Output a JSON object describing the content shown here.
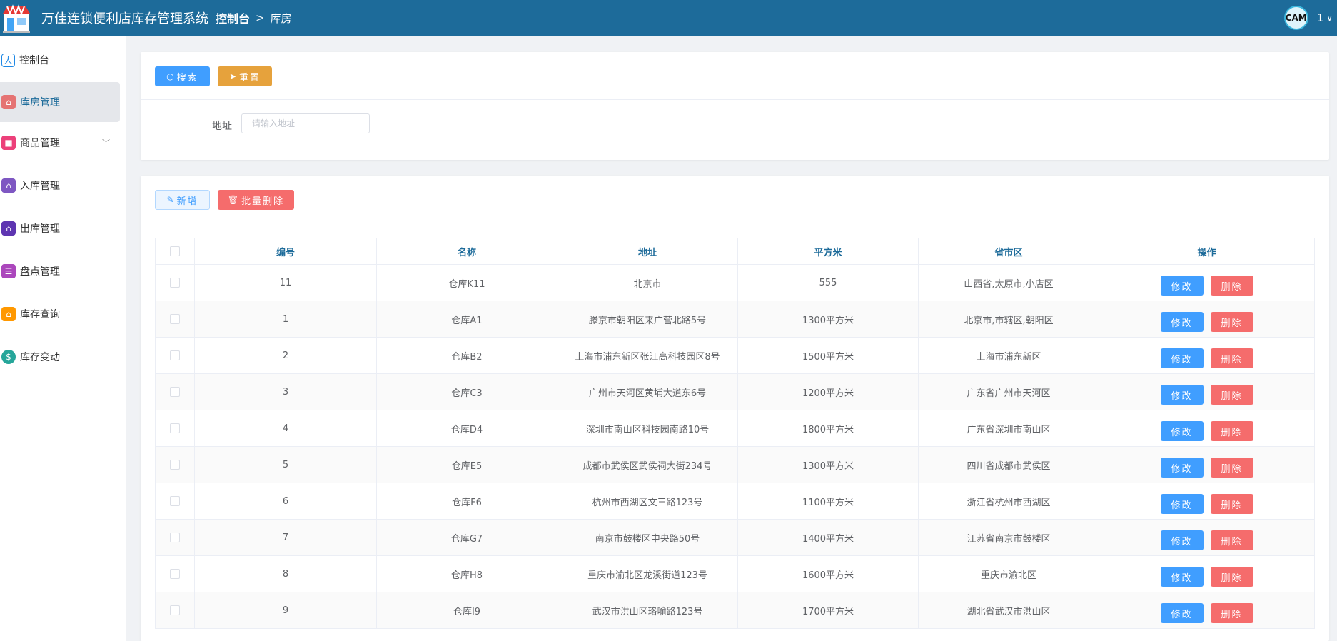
{
  "header": {
    "app_title": "万佳连锁便利店库存管理系统",
    "breadcrumb_home": "控制台",
    "breadcrumb_sep": ">",
    "breadcrumb_current": "库房",
    "avatar_text": "CAM",
    "user_name": "1",
    "user_chevron": "∨"
  },
  "sidebar": {
    "items": [
      {
        "label": "控制台",
        "icon": "dashboard-icon",
        "active": false
      },
      {
        "label": "库房管理",
        "icon": "warehouse-icon",
        "active": true
      },
      {
        "label": "商品管理",
        "icon": "goods-icon",
        "active": false,
        "chevron": "﹀"
      },
      {
        "label": "入库管理",
        "icon": "inbound-icon",
        "active": false
      },
      {
        "label": "出库管理",
        "icon": "outbound-icon",
        "active": false
      },
      {
        "label": "盘点管理",
        "icon": "inventory-check-icon",
        "active": false
      },
      {
        "label": "库存查询",
        "icon": "stock-query-icon",
        "active": false
      },
      {
        "label": "库存变动",
        "icon": "stock-change-icon",
        "active": false
      }
    ]
  },
  "search_card": {
    "search_label": "搜索",
    "reset_label": "重置",
    "address_label": "地址",
    "address_placeholder": "请输入地址",
    "address_value": ""
  },
  "table_card": {
    "add_label": "新增",
    "batch_delete_label": "批量删除",
    "columns": [
      "编号",
      "名称",
      "地址",
      "平方米",
      "省市区",
      "操作"
    ],
    "edit_label": "修改",
    "delete_label": "删除",
    "rows": [
      {
        "id": "11",
        "name": "仓库K11",
        "address": "北京市",
        "area": "555",
        "region": "山西省,太原市,小店区"
      },
      {
        "id": "1",
        "name": "仓库A1",
        "address": "滕京市朝阳区来广营北路5号",
        "area": "1300平方米",
        "region": "北京市,市辖区,朝阳区"
      },
      {
        "id": "2",
        "name": "仓库B2",
        "address": "上海市浦东新区张江高科技园区8号",
        "area": "1500平方米",
        "region": "上海市浦东新区"
      },
      {
        "id": "3",
        "name": "仓库C3",
        "address": "广州市天河区黄埔大道东6号",
        "area": "1200平方米",
        "region": "广东省广州市天河区"
      },
      {
        "id": "4",
        "name": "仓库D4",
        "address": "深圳市南山区科技园南路10号",
        "area": "1800平方米",
        "region": "广东省深圳市南山区"
      },
      {
        "id": "5",
        "name": "仓库E5",
        "address": "成都市武侯区武侯祠大街234号",
        "area": "1300平方米",
        "region": "四川省成都市武侯区"
      },
      {
        "id": "6",
        "name": "仓库F6",
        "address": "杭州市西湖区文三路123号",
        "area": "1100平方米",
        "region": "浙江省杭州市西湖区"
      },
      {
        "id": "7",
        "name": "仓库G7",
        "address": "南京市鼓楼区中央路50号",
        "area": "1400平方米",
        "region": "江苏省南京市鼓楼区"
      },
      {
        "id": "8",
        "name": "仓库H8",
        "address": "重庆市渝北区龙溪街道123号",
        "area": "1600平方米",
        "region": "重庆市渝北区"
      },
      {
        "id": "9",
        "name": "仓库I9",
        "address": "武汉市洪山区珞喻路123号",
        "area": "1700平方米",
        "region": "湖北省武汉市洪山区"
      }
    ]
  },
  "colors": {
    "header_bg": "#1d6b9a",
    "primary": "#409eff",
    "warning": "#e6a23c",
    "danger": "#f56c6c"
  }
}
